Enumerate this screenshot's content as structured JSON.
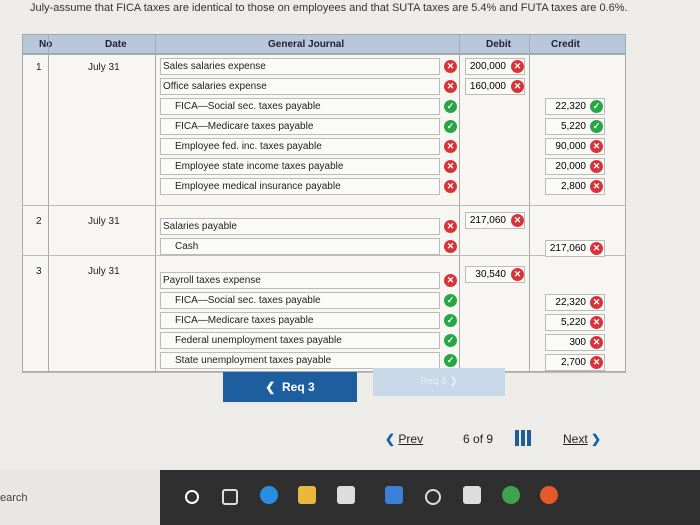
{
  "instruction": "July-assume that FICA taxes are identical to those on employees and that SUTA taxes are 5.4% and FUTA taxes are 0.6%.",
  "headers": {
    "no": "No",
    "date": "Date",
    "journal": "General Journal",
    "debit": "Debit",
    "credit": "Credit"
  },
  "entries": [
    {
      "no": "1",
      "date": "July 31",
      "lines": [
        {
          "account": "Sales salaries expense",
          "debit": "200,000",
          "credit": "",
          "status": "bad",
          "amt_status": "bad"
        },
        {
          "account": "Office salaries expense",
          "debit": "160,000",
          "credit": "",
          "status": "bad",
          "amt_status": "bad"
        },
        {
          "account": "FICA—Social sec. taxes payable",
          "debit": "",
          "credit": "22,320",
          "status": "good",
          "amt_status": "good"
        },
        {
          "account": "FICA—Medicare taxes payable",
          "debit": "",
          "credit": "5,220",
          "status": "good",
          "amt_status": "good"
        },
        {
          "account": "Employee fed. inc. taxes payable",
          "debit": "",
          "credit": "90,000",
          "status": "bad",
          "amt_status": "bad"
        },
        {
          "account": "Employee state income taxes payable",
          "debit": "",
          "credit": "20,000",
          "status": "bad",
          "amt_status": "bad"
        },
        {
          "account": "Employee medical insurance payable",
          "debit": "",
          "credit": "2,800",
          "status": "bad",
          "amt_status": "bad"
        }
      ]
    },
    {
      "no": "2",
      "date": "July 31",
      "lines": [
        {
          "account": "Salaries payable",
          "debit": "217,060",
          "credit": "",
          "status": "bad",
          "amt_status": "bad"
        },
        {
          "account": "Cash",
          "debit": "",
          "credit": "217,060",
          "status": "bad",
          "amt_status": "bad"
        }
      ]
    },
    {
      "no": "3",
      "date": "July 31",
      "lines": [
        {
          "account": "Payroll taxes expense",
          "debit": "30,540",
          "credit": "",
          "status": "bad",
          "amt_status": "bad"
        },
        {
          "account": "FICA—Social sec. taxes payable",
          "debit": "",
          "credit": "22,320",
          "status": "good",
          "amt_status": "bad"
        },
        {
          "account": "FICA—Medicare taxes payable",
          "debit": "",
          "credit": "5,220",
          "status": "good",
          "amt_status": "bad"
        },
        {
          "account": "Federal unemployment taxes payable",
          "debit": "",
          "credit": "300",
          "status": "good",
          "amt_status": "bad"
        },
        {
          "account": "State unemployment taxes payable",
          "debit": "",
          "credit": "2,700",
          "status": "good",
          "amt_status": "bad"
        }
      ]
    }
  ],
  "buttons": {
    "req3": "Req 3",
    "req4": "Req 4"
  },
  "pager": {
    "prev": "Prev",
    "page": "6",
    "of": "of",
    "total": "9",
    "next": "Next"
  },
  "taskbar": {
    "search": "earch"
  },
  "colors": {
    "bad": "#d6333a",
    "good": "#27a644",
    "header": "#b8c8da",
    "req3": "#1d5f9e"
  }
}
